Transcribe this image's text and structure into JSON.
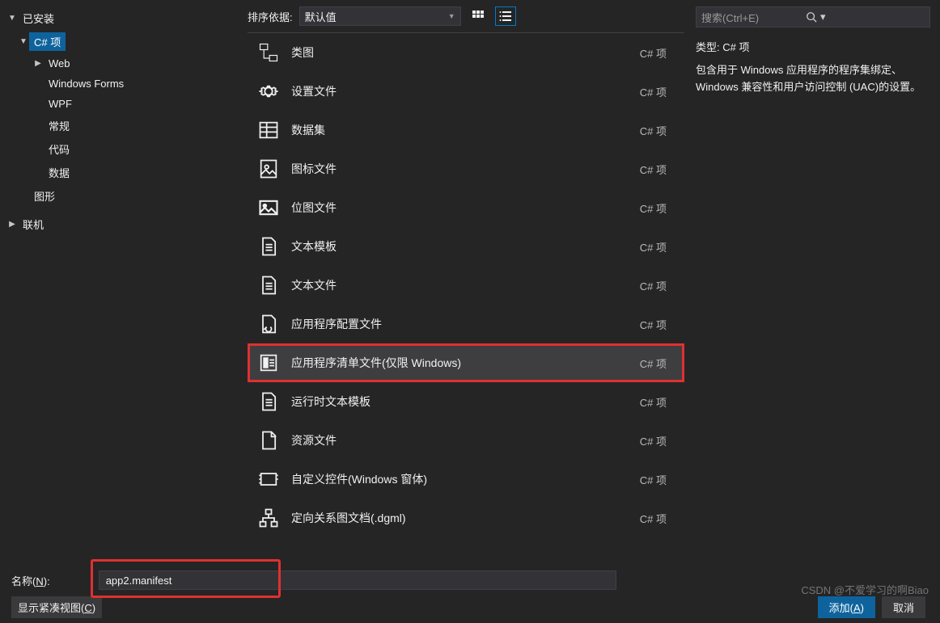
{
  "left": {
    "installed": "已安装",
    "items": [
      {
        "label": "C# 项",
        "selected": true,
        "expanded": true,
        "level": 1
      },
      {
        "label": "Web",
        "expanded": false,
        "level": 2,
        "caret": true
      },
      {
        "label": "Windows Forms",
        "level": 2
      },
      {
        "label": "WPF",
        "level": 2
      },
      {
        "label": "常规",
        "level": 2
      },
      {
        "label": "代码",
        "level": 2
      },
      {
        "label": "数据",
        "level": 2
      },
      {
        "label": "图形",
        "level": 1
      }
    ],
    "online": "联机"
  },
  "sort": {
    "label": "排序依据:",
    "value": "默认值"
  },
  "templates": [
    {
      "name": "类图",
      "type": "C# 项",
      "icon": "class-diagram"
    },
    {
      "name": "设置文件",
      "type": "C# 项",
      "icon": "gear"
    },
    {
      "name": "数据集",
      "type": "C# 项",
      "icon": "dataset"
    },
    {
      "name": "图标文件",
      "type": "C# 项",
      "icon": "icon-file"
    },
    {
      "name": "位图文件",
      "type": "C# 项",
      "icon": "image"
    },
    {
      "name": "文本模板",
      "type": "C# 项",
      "icon": "doc"
    },
    {
      "name": "文本文件",
      "type": "C# 项",
      "icon": "doc"
    },
    {
      "name": "应用程序配置文件",
      "type": "C# 项",
      "icon": "wrench"
    },
    {
      "name": "应用程序清单文件(仅限 Windows)",
      "type": "C# 项",
      "icon": "manifest",
      "highlighted": true
    },
    {
      "name": "运行时文本模板",
      "type": "C# 项",
      "icon": "doc"
    },
    {
      "name": "资源文件",
      "type": "C# 项",
      "icon": "resource"
    },
    {
      "name": "自定义控件(Windows 窗体)",
      "type": "C# 项",
      "icon": "control"
    },
    {
      "name": "定向关系图文档(.dgml)",
      "type": "C# 项",
      "icon": "graph"
    }
  ],
  "search": {
    "placeholder": "搜索(Ctrl+E)"
  },
  "details": {
    "type_label": "类型:",
    "type_value": "C# 项",
    "description": "包含用于 Windows 应用程序的程序集绑定、Windows 兼容性和用户访问控制 (UAC)的设置。"
  },
  "name_row": {
    "label_pre": "名称(",
    "label_ul": "N",
    "label_post": "):",
    "value": "app2.manifest"
  },
  "footer": {
    "compact_pre": "显示紧凑视图(",
    "compact_ul": "C",
    "compact_post": ")",
    "add_pre": "添加(",
    "add_ul": "A",
    "add_post": ")",
    "cancel": "取消"
  },
  "watermark": "CSDN @不爱学习的啊Biao"
}
